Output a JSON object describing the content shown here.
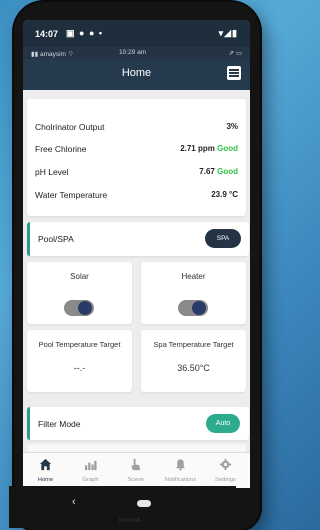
{
  "system_status": {
    "time": "14:07",
    "left_icons": "▣ ● ● •",
    "right_icons": "▾◢▮"
  },
  "ios_status": {
    "carrier": "▮▮ amaysim ⌔",
    "time": "10:29 am",
    "right": "⇗ ▭"
  },
  "header": {
    "title": "Home"
  },
  "stats": [
    {
      "label": "Cholrinator Output",
      "value": "3%",
      "badge": ""
    },
    {
      "label": "Free Chlorine",
      "value": "2.71 ppm",
      "badge": "Good"
    },
    {
      "label": "pH Level",
      "value": "7.67",
      "badge": "Good"
    },
    {
      "label": "Water Temperature",
      "value": "23.9 °C",
      "badge": ""
    }
  ],
  "pool_spa": {
    "label": "Pool/SPA",
    "button": "SPA"
  },
  "solar": {
    "label": "Solar",
    "toggle_on": true
  },
  "heater": {
    "label": "Heater",
    "toggle_on": true
  },
  "pool_temp": {
    "label": "Pool Temperature Target",
    "value": "--.-"
  },
  "spa_temp": {
    "label": "Spa Temperature Target",
    "value": "36.50°C"
  },
  "filter_mode": {
    "label": "Filter Mode",
    "button": "Auto"
  },
  "tabs": [
    {
      "label": "Home",
      "icon": "home-icon",
      "active": true
    },
    {
      "label": "Graph",
      "icon": "graph-icon",
      "active": false
    },
    {
      "label": "Scene",
      "icon": "scene-icon",
      "active": false
    },
    {
      "label": "Notifications",
      "icon": "bell-icon",
      "active": false
    },
    {
      "label": "Settings",
      "icon": "gear-icon",
      "active": false
    }
  ],
  "nav": {
    "back": "‹"
  },
  "device_brand": "NOKIA",
  "colors": {
    "header": "#263a4d",
    "good": "#31c248",
    "accent": "#2e9a8d",
    "auto_button": "#2eaa8e",
    "toggle_knob": "#2b3b67"
  }
}
